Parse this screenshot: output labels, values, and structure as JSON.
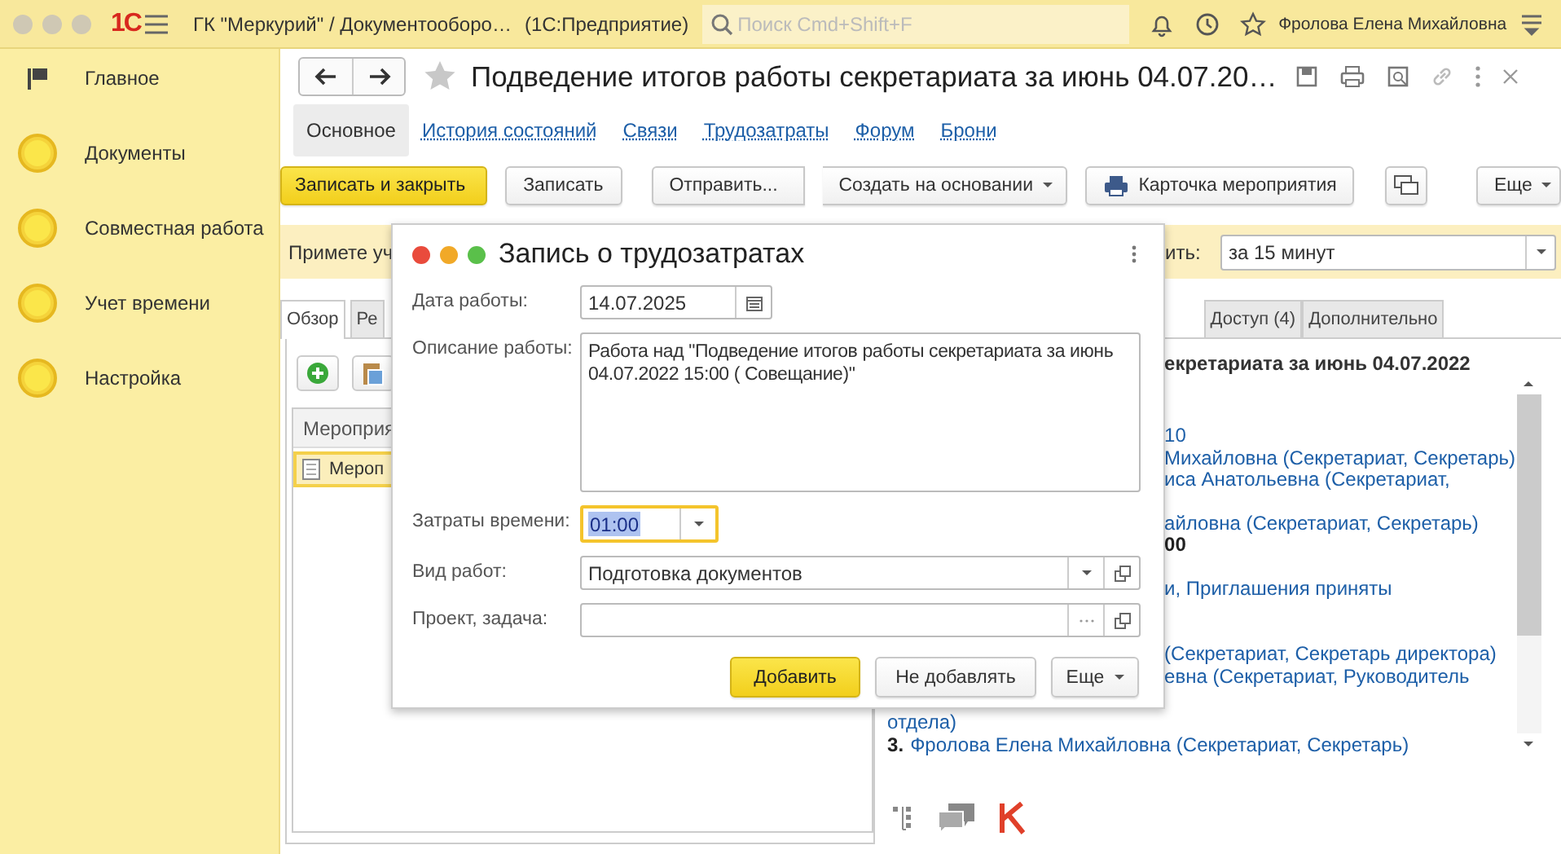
{
  "window": {
    "logo": "1С",
    "title": "ГК \"Меркурий\" / Документооборо…",
    "app_name": "(1С:Предприятие)"
  },
  "search": {
    "placeholder": "Поиск Cmd+Shift+F"
  },
  "user": "Фролова Елена Михайловна",
  "sidebar": {
    "items": [
      {
        "label": "Главное",
        "kind": "flag"
      },
      {
        "label": "Документы",
        "kind": "circle"
      },
      {
        "label": "Совместная работа",
        "kind": "circle"
      },
      {
        "label": "Учет времени",
        "kind": "circle"
      },
      {
        "label": "Настройка",
        "kind": "circle"
      }
    ]
  },
  "form": {
    "title": "Подведение итогов работы секретариата за июнь 04.07.20…",
    "tabs": [
      {
        "label": "Основное",
        "selected": true
      },
      {
        "label": "История состояний",
        "selected": false
      },
      {
        "label": "Связи",
        "selected": false
      },
      {
        "label": "Трудозатраты",
        "selected": false
      },
      {
        "label": "Форум",
        "selected": false
      },
      {
        "label": "Брони",
        "selected": false
      }
    ],
    "toolbar": [
      {
        "kind": "default",
        "label": "Записать и закрыть"
      },
      {
        "kind": "plain",
        "label": "Записать"
      },
      {
        "kind": "group-start",
        "label": "Отправить..."
      },
      {
        "kind": "group-end-dropdown",
        "label": "Создать на основании"
      },
      {
        "kind": "printer",
        "label": "Карточка мероприятия"
      },
      {
        "kind": "comment"
      },
      {
        "kind": "dropdown",
        "label": "Еще"
      }
    ],
    "notice": {
      "text_left": "Примете уч",
      "text_right": "ить:",
      "select_value": "за 15 минут"
    },
    "tabs_left": [
      {
        "label": "Обзор",
        "selected": true
      },
      {
        "label": "Ре",
        "selected": false
      }
    ],
    "tabs_right": [
      {
        "label": "Доступ (4)",
        "selected": false
      },
      {
        "label": "Дополнительно",
        "selected": false
      }
    ],
    "list": {
      "column": "Мероприя",
      "rows": [
        {
          "text": "Мероп",
          "selected": true
        }
      ]
    },
    "details": {
      "heading": "екретариата за июнь 04.07.2022",
      "groups_beside_dialog": [
        [
          {
            "kind": "link",
            "text": "10"
          },
          {
            "kind": "link",
            "text": "Михайловна (Секретариат, Секретарь)"
          },
          {
            "kind": "link",
            "text": "иса Анатольевна (Секретариат,"
          }
        ],
        [
          {
            "kind": "link",
            "text": "айловна (Секретариат, Секретарь)"
          },
          {
            "kind": "bold",
            "text": "00"
          }
        ],
        [
          {
            "kind": "link",
            "text": "и, Приглашения приняты"
          }
        ],
        [
          {
            "kind": "link",
            "text": "(Секретариат, Секретарь директора)"
          },
          {
            "kind": "link",
            "text": "евна (Секретариат, Руководитель"
          }
        ]
      ],
      "lines_below_dialog": [
        {
          "kind": "link",
          "text": "отдела)"
        },
        {
          "kind": "numbered",
          "number": "3.",
          "text": "Фролова Елена Михайловна (Секретариат, Секретарь)"
        }
      ]
    }
  },
  "dialog": {
    "title": "Запись о трудозатратах",
    "fields": [
      {
        "kind": "date",
        "label": "Дата работы:",
        "value": "14.07.2025"
      },
      {
        "kind": "textarea",
        "label": "Описание работы:",
        "value": "Работа над \"Подведение итогов работы секретариата за июнь 04.07.2022 15:00 ( Совещание)\""
      },
      {
        "kind": "time",
        "label": "Затраты времени:",
        "value": "01:00",
        "focused": true
      },
      {
        "kind": "select",
        "label": "Вид работ:",
        "value": "Подготовка документов"
      },
      {
        "kind": "choice",
        "label": "Проект, задача:"
      }
    ],
    "buttons": [
      {
        "kind": "default",
        "label": "Добавить"
      },
      {
        "kind": "plain",
        "label": "Не добавлять"
      },
      {
        "kind": "dropdown",
        "label": "Еще"
      }
    ]
  }
}
